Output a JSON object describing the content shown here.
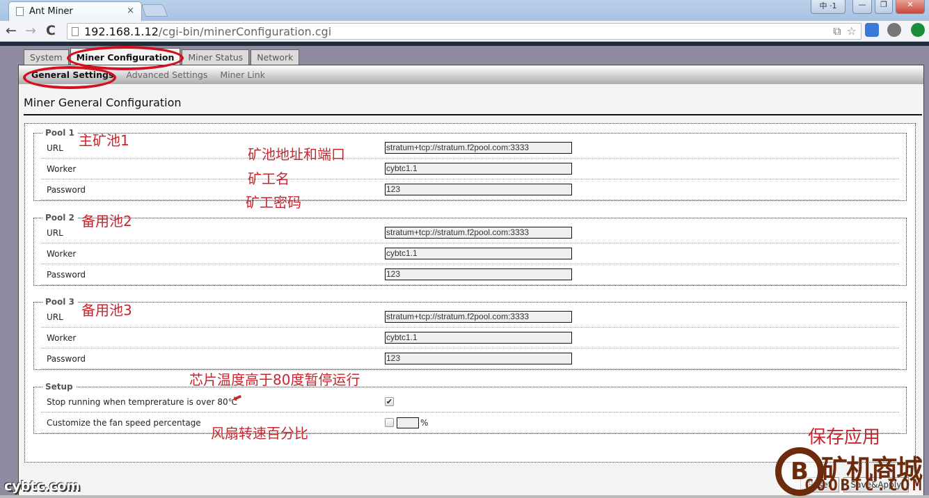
{
  "browser": {
    "tab_title": "Ant Miner",
    "tab_close": "×",
    "url_host": "192.168.1.12",
    "url_path": "/cgi-bin/minerConfiguration.cgi",
    "back": "←",
    "forward": "→",
    "reload": "C",
    "ime_label": "中 ·1",
    "minimize": "—",
    "maximize": "❐",
    "close": "✕"
  },
  "main_tabs": [
    {
      "label": "System"
    },
    {
      "label": "Miner Configuration",
      "active": true
    },
    {
      "label": "Miner Status"
    },
    {
      "label": "Network"
    }
  ],
  "sub_tabs": [
    {
      "label": "General Settings",
      "active": true
    },
    {
      "label": "Advanced Settings"
    },
    {
      "label": "Miner Link"
    }
  ],
  "page_title": "Miner General Configuration",
  "pools": [
    {
      "legend": "Pool 1",
      "annotation": "主矿池1",
      "url_label": "URL",
      "url": "stratum+tcp://stratum.f2pool.com:3333",
      "worker_label": "Worker",
      "worker": "cybtc1.1",
      "password_label": "Password",
      "password": "123"
    },
    {
      "legend": "Pool 2",
      "annotation": "备用池2",
      "url_label": "URL",
      "url": "stratum+tcp://stratum.f2pool.com:3333",
      "worker_label": "Worker",
      "worker": "cybtc1.1",
      "password_label": "Password",
      "password": "123"
    },
    {
      "legend": "Pool 3",
      "annotation": "备用池3",
      "url_label": "URL",
      "url": "stratum+tcp://stratum.f2pool.com:3333",
      "worker_label": "Worker",
      "worker": "cybtc1.1",
      "password_label": "Password",
      "password": "123"
    }
  ],
  "field_annotations": {
    "url": "矿池地址和端口",
    "worker": "矿工名",
    "password": "矿工密码"
  },
  "setup": {
    "legend": "Setup",
    "stop_label": "Stop running when temprerature is over 80℃",
    "stop_checked": true,
    "stop_check_glyph": "✔",
    "stop_annotation": "芯片温度高于80度暂停运行",
    "fan_label": "Customize the fan speed percentage",
    "fan_checked": false,
    "fan_value": "",
    "fan_unit": "%",
    "fan_annotation": "风扇转速百分比"
  },
  "buttons": {
    "reset": "Reset",
    "save": "Save&Apply",
    "save_annotation": "保存应用"
  },
  "watermarks": {
    "left": "cybtc.com",
    "logo_glyph": "B",
    "right_text": "矿机商城",
    "right_url": "COOBTC.COM"
  },
  "colors": {
    "annotation_red": "#c8252d",
    "watermark_brown": "#6b2b0c"
  }
}
